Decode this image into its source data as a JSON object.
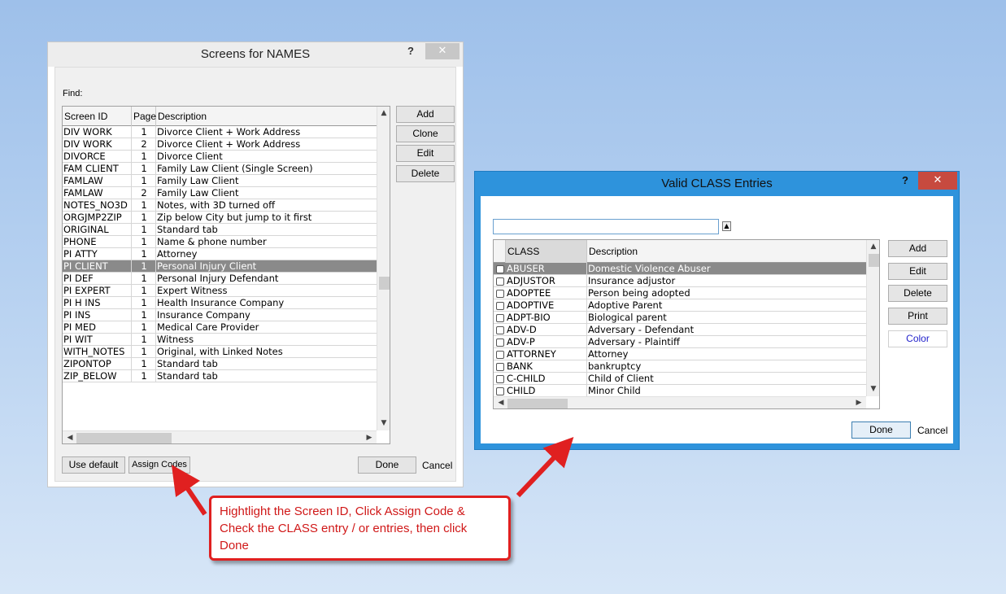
{
  "screens_window": {
    "title": "Screens for NAMES",
    "help": "?",
    "close": "✕",
    "find_label": "Find:",
    "columns": [
      "Screen ID",
      "Page",
      "Description"
    ],
    "rows": [
      {
        "id": "DIV WORK",
        "page": "1",
        "desc": "Divorce Client + Work Address"
      },
      {
        "id": "DIV WORK",
        "page": "2",
        "desc": "Divorce Client + Work Address"
      },
      {
        "id": "DIVORCE",
        "page": "1",
        "desc": "Divorce Client"
      },
      {
        "id": "FAM CLIENT",
        "page": "1",
        "desc": "Family Law Client (Single Screen)"
      },
      {
        "id": "FAMLAW",
        "page": "1",
        "desc": "Family Law Client"
      },
      {
        "id": "FAMLAW",
        "page": "2",
        "desc": "Family Law  Client"
      },
      {
        "id": "NOTES_NO3D",
        "page": "1",
        "desc": "Notes, with 3D turned off"
      },
      {
        "id": "ORGJMP2ZIP",
        "page": "1",
        "desc": "Zip below City but jump to it first"
      },
      {
        "id": "ORIGINAL",
        "page": "1",
        "desc": "Standard tab"
      },
      {
        "id": "PHONE",
        "page": "1",
        "desc": "Name & phone number"
      },
      {
        "id": "PI ATTY",
        "page": "1",
        "desc": "Attorney"
      },
      {
        "id": "PI CLIENT",
        "page": "1",
        "desc": "Personal Injury Client",
        "selected": true
      },
      {
        "id": "PI DEF",
        "page": "1",
        "desc": "Personal Injury Defendant"
      },
      {
        "id": "PI EXPERT",
        "page": "1",
        "desc": "Expert Witness"
      },
      {
        "id": "PI H INS",
        "page": "1",
        "desc": "Health Insurance Company"
      },
      {
        "id": "PI INS",
        "page": "1",
        "desc": "Insurance Company"
      },
      {
        "id": "PI MED",
        "page": "1",
        "desc": "Medical Care Provider"
      },
      {
        "id": "PI WIT",
        "page": "1",
        "desc": "Witness"
      },
      {
        "id": "WITH_NOTES",
        "page": "1",
        "desc": "Original, with Linked Notes"
      },
      {
        "id": "ZIPONTOP",
        "page": "1",
        "desc": "Standard tab"
      },
      {
        "id": "ZIP_BELOW",
        "page": "1",
        "desc": "Standard tab"
      }
    ],
    "side_buttons": {
      "add": "Add",
      "clone": "Clone",
      "edit": "Edit",
      "delete": "Delete"
    },
    "bottom_buttons": {
      "use_default": "Use default",
      "assign_codes": "Assign Codes",
      "done": "Done",
      "cancel": "Cancel"
    }
  },
  "class_window": {
    "title": "Valid CLASS Entries",
    "help": "?",
    "close": "✕",
    "search_value": "",
    "columns": [
      "CLASS",
      "Description"
    ],
    "rows": [
      {
        "cls": "ABUSER",
        "desc": "Domestic Violence Abuser",
        "selected": true
      },
      {
        "cls": "ADJUSTOR",
        "desc": "Insurance adjustor"
      },
      {
        "cls": "ADOPTEE",
        "desc": "Person being adopted"
      },
      {
        "cls": "ADOPTIVE",
        "desc": "Adoptive Parent"
      },
      {
        "cls": "ADPT-BIO",
        "desc": "Biological parent"
      },
      {
        "cls": "ADV-D",
        "desc": "Adversary - Defendant"
      },
      {
        "cls": "ADV-P",
        "desc": "Adversary - Plaintiff"
      },
      {
        "cls": "ATTORNEY",
        "desc": "Attorney"
      },
      {
        "cls": "BANK",
        "desc": "bankruptcy"
      },
      {
        "cls": "C-CHILD",
        "desc": "Child of Client"
      },
      {
        "cls": "CHILD",
        "desc": "Minor Child"
      }
    ],
    "side_buttons": {
      "add": "Add",
      "edit": "Edit",
      "delete": "Delete",
      "print": "Print",
      "color": "Color"
    },
    "bottom_buttons": {
      "done": "Done",
      "cancel": "Cancel"
    }
  },
  "callout": {
    "line1": "Hightlight the Screen ID, Click Assign Code &",
    "line2": "Check the CLASS entry / or entries, then click",
    "line3": "Done"
  },
  "colors": {
    "accent_blue": "#2e93dc",
    "close_red": "#c74a3f",
    "callout_red": "#e02020",
    "selection": "#8a8a8a"
  }
}
